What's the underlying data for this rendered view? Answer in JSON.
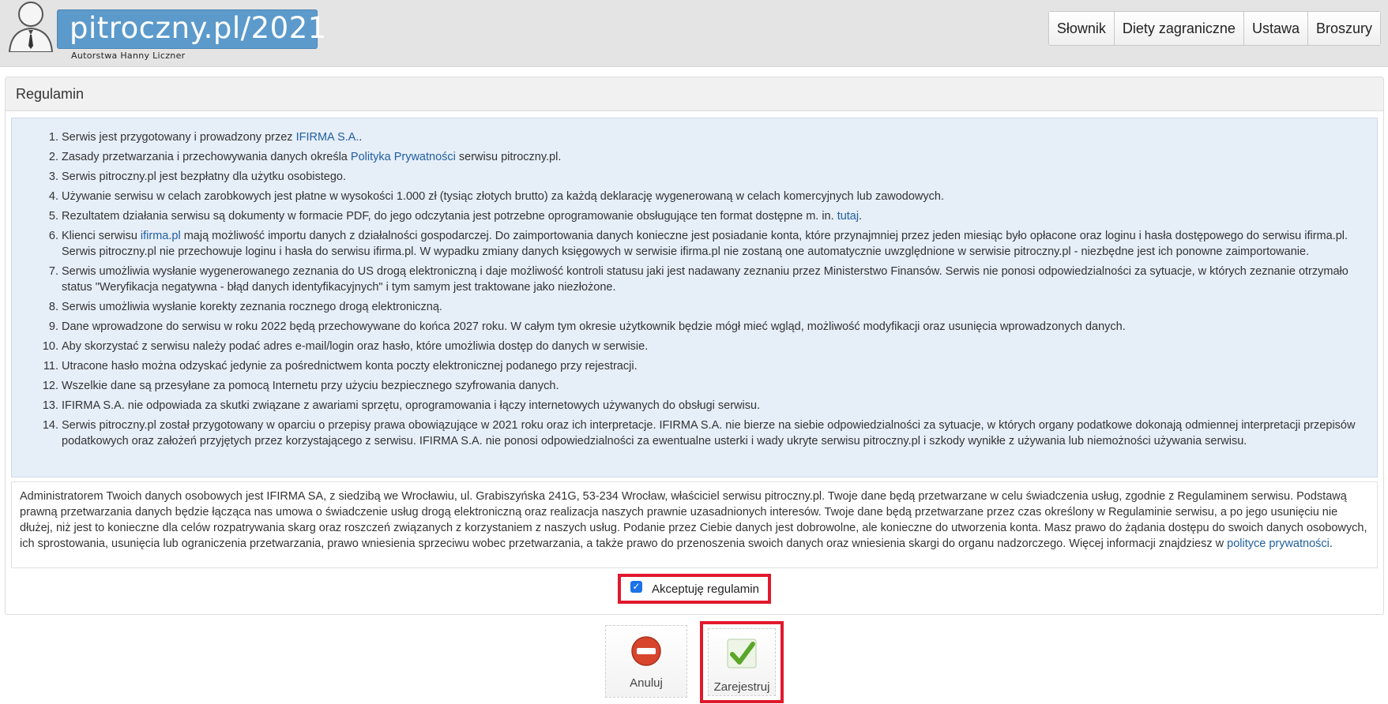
{
  "header": {
    "logo_text": "pitroczny.pl/2021",
    "logo_sub": "Autorstwa Hanny Liczner",
    "colors": {
      "logo_bg": "#5c9acb",
      "header_bg": "#e4e4e4"
    },
    "nav": [
      {
        "label": "Słownik"
      },
      {
        "label": "Diety zagraniczne"
      },
      {
        "label": "Ustawa"
      },
      {
        "label": "Broszury"
      }
    ]
  },
  "panel": {
    "heading": "Regulamin",
    "rules": [
      {
        "pre": "Serwis jest przygotowany i prowadzony przez ",
        "link": "IFIRMA S.A.",
        "post": "."
      },
      {
        "pre": "Zasady przetwarzania i przechowywania danych określa ",
        "link": "Polityka Prywatności",
        "post": " serwisu pitroczny.pl."
      },
      {
        "pre": "Serwis pitroczny.pl jest bezpłatny dla użytku osobistego.",
        "link": "",
        "post": ""
      },
      {
        "pre": "Używanie serwisu w celach zarobkowych jest płatne w wysokości 1.000 zł (tysiąc złotych brutto) za każdą deklarację wygenerowaną w celach komercyjnych lub zawodowych.",
        "link": "",
        "post": ""
      },
      {
        "pre": "Rezultatem działania serwisu są dokumenty w formacie PDF, do jego odczytania jest potrzebne oprogramowanie obsługujące ten format dostępne m. in. ",
        "link": "tutaj",
        "post": "."
      },
      {
        "pre": "Klienci serwisu ",
        "link": "ifirma.pl",
        "post": " mają możliwość importu danych z działalności gospodarczej. Do zaimportowania danych konieczne jest posiadanie konta, które przynajmniej przez jeden miesiąc było opłacone oraz loginu i hasła dostępowego do serwisu ifirma.pl. Serwis pitroczny.pl nie przechowuje loginu i hasła do serwisu ifirma.pl. W wypadku zmiany danych księgowych w serwisie ifirma.pl nie zostaną one automatycznie uwzględnione w serwisie pitroczny.pl - niezbędne jest ich ponowne zaimportowanie."
      },
      {
        "pre": "Serwis umożliwia wysłanie wygenerowanego zeznania do US drogą elektroniczną i daje możliwość kontroli statusu jaki jest nadawany zeznaniu przez Ministerstwo Finansów. Serwis nie ponosi odpowiedzialności za sytuacje, w których zeznanie otrzymało status \"Weryfikacja negatywna - błąd danych identyfikacyjnych\" i tym samym jest traktowane jako niezłożone.",
        "link": "",
        "post": ""
      },
      {
        "pre": "Serwis umożliwia wysłanie korekty zeznania rocznego drogą elektroniczną.",
        "link": "",
        "post": ""
      },
      {
        "pre": "Dane wprowadzone do serwisu w roku 2022 będą przechowywane do końca 2027 roku. W całym tym okresie użytkownik będzie mógł mieć wgląd, możliwość modyfikacji oraz usunięcia wprowadzonych danych.",
        "link": "",
        "post": ""
      },
      {
        "pre": "Aby skorzystać z serwisu należy podać adres e-mail/login oraz hasło, które umożliwia dostęp do danych w serwisie.",
        "link": "",
        "post": ""
      },
      {
        "pre": "Utracone hasło można odzyskać jedynie za pośrednictwem konta poczty elektronicznej podanego przy rejestracji.",
        "link": "",
        "post": ""
      },
      {
        "pre": "Wszelkie dane są przesyłane za pomocą Internetu przy użyciu bezpiecznego szyfrowania danych.",
        "link": "",
        "post": ""
      },
      {
        "pre": "IFIRMA S.A. nie odpowiada za skutki związane z awariami sprzętu, oprogramowania i łączy internetowych używanych do obsługi serwisu.",
        "link": "",
        "post": ""
      },
      {
        "pre": "Serwis pitroczny.pl został przygotowany w oparciu o przepisy prawa obowiązujące w 2021 roku oraz ich interpretacje. IFIRMA S.A. nie bierze na siebie odpowiedzialności za sytuacje, w których organy podatkowe dokonają odmiennej interpretacji przepisów podatkowych oraz założeń przyjętych przez korzystającego z serwisu. IFIRMA S.A. nie ponosi odpowiedzialności za ewentualne usterki i wady ukryte serwisu pitroczny.pl i szkody wynikłe z używania lub niemożności używania serwisu.",
        "link": "",
        "post": ""
      }
    ],
    "privacy": {
      "text": "Administratorem Twoich danych osobowych jest IFIRMA SA, z siedzibą we Wrocławiu, ul. Grabiszyńska 241G, 53-234 Wrocław, właściciel serwisu pitroczny.pl. Twoje dane będą przetwarzane w celu świadczenia usług, zgodnie z Regulaminem serwisu. Podstawą prawną przetwarzania danych będzie łącząca nas umowa o świadczenie usług drogą elektroniczną oraz realizacja naszych prawnie uzasadnionych interesów. Twoje dane będą przetwarzane przez czas określony w Regulaminie serwisu, a po jego usunięciu nie dłużej, niż jest to konieczne dla celów rozpatrywania skarg oraz roszczeń związanych z korzystaniem z naszych usług. Podanie przez Ciebie danych jest dobrowolne, ale konieczne do utworzenia konta. Masz prawo do żądania dostępu do swoich danych osobowych, ich sprostowania, usunięcia lub ograniczenia przetwarzania, prawo wniesienia sprzeciwu wobec przetwarzania, a także prawo do przenoszenia swoich danych oraz wniesienia skargi do organu nadzorczego. Więcej informacji znajdziesz w ",
      "link": "polityce prywatności",
      "post": "."
    },
    "accept_label": "Akceptuję regulamin",
    "accept_checked": true
  },
  "buttons": {
    "cancel_label": "Anuluj",
    "register_label": "Zarejestruj",
    "cancel_icon": "no-entry-icon",
    "register_icon": "checkmark-icon"
  },
  "colors": {
    "link": "#1f5f9e",
    "highlight": "#e0192d",
    "info_bg": "#e6eef8"
  }
}
